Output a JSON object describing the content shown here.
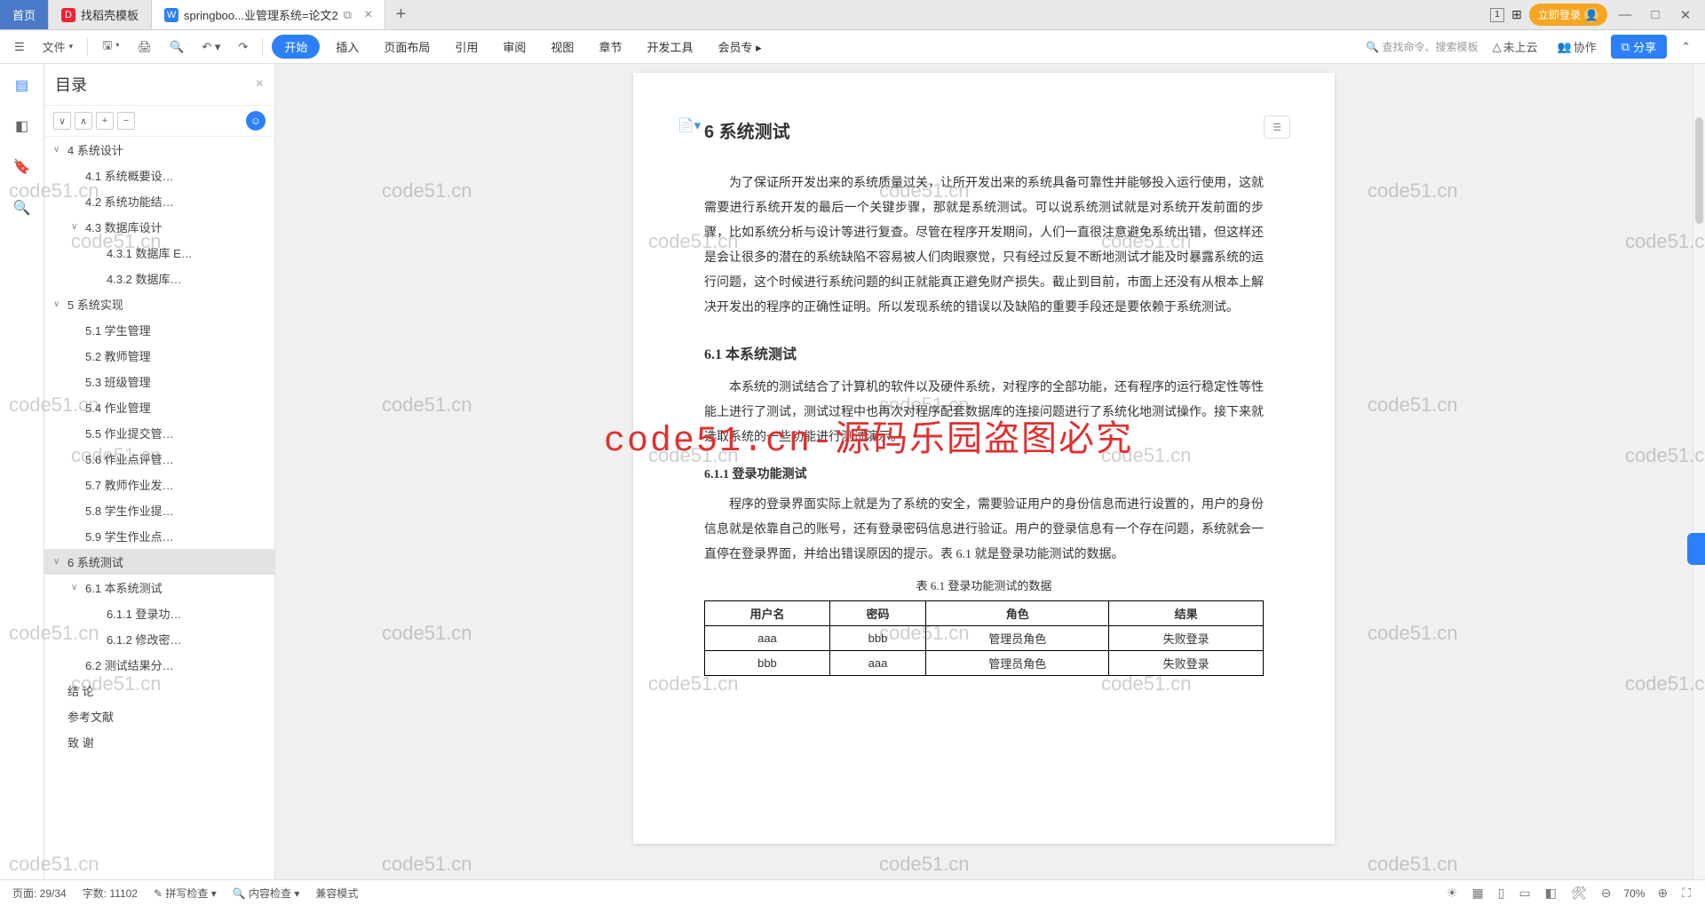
{
  "tabs": {
    "home": "首页",
    "t1": "找稻壳模板",
    "t2": "springboo...业管理系统=论文2"
  },
  "login": "立即登录",
  "menu": {
    "file": "文件",
    "start": "开始",
    "insert": "插入",
    "layout": "页面布局",
    "ref": "引用",
    "review": "审阅",
    "view": "视图",
    "chapter": "章节",
    "dev": "开发工具",
    "member": "会员专"
  },
  "searchph": "查找命令、搜索模板",
  "cloud": "未上云",
  "coop": "协作",
  "share": "分享",
  "sidebar": {
    "title": "目录",
    "items": [
      {
        "lvl": 0,
        "arrow": "∨",
        "label": "4 系统设计",
        "sel": false
      },
      {
        "lvl": 1,
        "arrow": "",
        "label": "4.1 系统概要设…",
        "sel": false
      },
      {
        "lvl": 1,
        "arrow": "",
        "label": "4.2 系统功能结…",
        "sel": false
      },
      {
        "lvl": 1,
        "arrow": "∨",
        "label": "4.3 数据库设计",
        "sel": false
      },
      {
        "lvl": 2,
        "arrow": "",
        "label": "4.3.1 数据库 E…",
        "sel": false
      },
      {
        "lvl": 2,
        "arrow": "",
        "label": "4.3.2 数据库…",
        "sel": false
      },
      {
        "lvl": 0,
        "arrow": "∨",
        "label": "5 系统实现",
        "sel": false
      },
      {
        "lvl": 1,
        "arrow": "",
        "label": "5.1 学生管理",
        "sel": false
      },
      {
        "lvl": 1,
        "arrow": "",
        "label": "5.2 教师管理",
        "sel": false
      },
      {
        "lvl": 1,
        "arrow": "",
        "label": "5.3 班级管理",
        "sel": false
      },
      {
        "lvl": 1,
        "arrow": "",
        "label": "5.4 作业管理",
        "sel": false
      },
      {
        "lvl": 1,
        "arrow": "",
        "label": "5.5 作业提交管…",
        "sel": false
      },
      {
        "lvl": 1,
        "arrow": "",
        "label": "5.6 作业点评管…",
        "sel": false
      },
      {
        "lvl": 1,
        "arrow": "",
        "label": "5.7 教师作业发…",
        "sel": false
      },
      {
        "lvl": 1,
        "arrow": "",
        "label": "5.8 学生作业提…",
        "sel": false
      },
      {
        "lvl": 1,
        "arrow": "",
        "label": "5.9 学生作业点…",
        "sel": false
      },
      {
        "lvl": 0,
        "arrow": "∨",
        "label": "6 系统测试",
        "sel": true
      },
      {
        "lvl": 1,
        "arrow": "∨",
        "label": "6.1 本系统测试",
        "sel": false
      },
      {
        "lvl": 2,
        "arrow": "",
        "label": "6.1.1 登录功…",
        "sel": false
      },
      {
        "lvl": 2,
        "arrow": "",
        "label": "6.1.2 修改密…",
        "sel": false
      },
      {
        "lvl": 1,
        "arrow": "",
        "label": "6.2 测试结果分…",
        "sel": false
      },
      {
        "lvl": 0,
        "arrow": "",
        "label": "结   论",
        "sel": false
      },
      {
        "lvl": 0,
        "arrow": "",
        "label": "参考文献",
        "sel": false
      },
      {
        "lvl": 0,
        "arrow": "",
        "label": "致   谢",
        "sel": false
      }
    ]
  },
  "doc": {
    "h1": "6 系统测试",
    "p1": "为了保证所开发出来的系统质量过关，让所开发出来的系统具备可靠性并能够投入运行使用，这就需要进行系统开发的最后一个关键步骤，那就是系统测试。可以说系统测试就是对系统开发前面的步骤，比如系统分析与设计等进行复查。尽管在程序开发期间，人们一直很注意避免系统出错，但这样还是会让很多的潜在的系统缺陷不容易被人们肉眼察觉，只有经过反复不断地测试才能及时暴露系统的运行问题，这个时候进行系统问题的纠正就能真正避免财产损失。截止到目前，市面上还没有从根本上解决开发出的程序的正确性证明。所以发现系统的错误以及缺陷的重要手段还是要依赖于系统测试。",
    "h2_1": "6.1  本系统测试",
    "p2": "本系统的测试结合了计算机的软件以及硬件系统，对程序的全部功能，还有程序的运行稳定性等性能上进行了测试，测试过程中也再次对程序配套数据库的连接问题进行了系统化地测试操作。接下来就选取系统的一些功能进行测试演示。",
    "h3_1": "6.1.1 登录功能测试",
    "p3": "程序的登录界面实际上就是为了系统的安全，需要验证用户的身份信息而进行设置的，用户的身份信息就是依靠自己的账号，还有登录密码信息进行验证。用户的登录信息有一个存在问题，系统就会一直停在登录界面，并给出错误原因的提示。表 6.1 就是登录功能测试的数据。",
    "caption": "表 6.1 登录功能测试的数据",
    "table": {
      "head": [
        "用户名",
        "密码",
        "角色",
        "结果"
      ],
      "rows": [
        [
          "aaa",
          "bbb",
          "管理员角色",
          "失败登录"
        ],
        [
          "bbb",
          "aaa",
          "管理员角色",
          "失败登录"
        ]
      ]
    }
  },
  "watermark_text": "code51.cn",
  "wm_red": "code51.cn-源码乐园盗图必究",
  "status": {
    "page": "页面: 29/34",
    "words": "字数: 11102",
    "spell": "拼写检查",
    "content": "内容检查",
    "compat": "兼容模式",
    "zoom": "70%"
  }
}
